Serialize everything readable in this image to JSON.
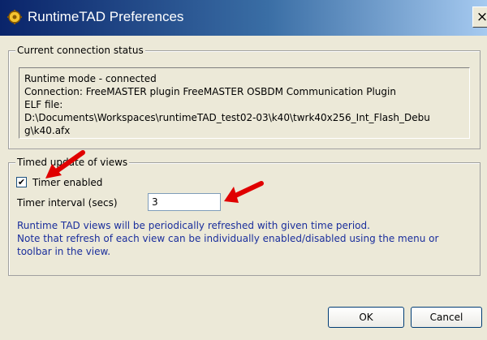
{
  "window": {
    "title": "RuntimeTAD Preferences",
    "close_glyph": "×"
  },
  "connection_group": {
    "legend": "Current connection status",
    "lines": [
      "Runtime mode - connected",
      "Connection: FreeMASTER plugin FreeMASTER OSBDM Communication Plugin",
      "ELF file:",
      "D:\\Documents\\Workspaces\\runtimeTAD_test02-03\\k40\\twrk40x256_Int_Flash_Debu",
      "g\\k40.afx"
    ]
  },
  "timed_group": {
    "legend": "Timed update of views",
    "checkbox_label": "Timer enabled",
    "checkbox_checked": true,
    "check_glyph": "✔",
    "interval_label": "Timer interval (secs)",
    "interval_value": "3",
    "note_lines": [
      "Runtime TAD views will be periodically refreshed with given time period.",
      "Note that refresh of each view can be individually enabled/disabled using the menu or",
      "toolbar in the view."
    ]
  },
  "buttons": {
    "ok": "OK",
    "cancel": "Cancel"
  },
  "colors": {
    "title_gradient_start": "#0A246A",
    "note_text": "#1A2E9C",
    "arrow": "#E00000"
  },
  "icons": {
    "title": "preferences-gear-icon",
    "arrow": "red-annotation-arrow"
  }
}
